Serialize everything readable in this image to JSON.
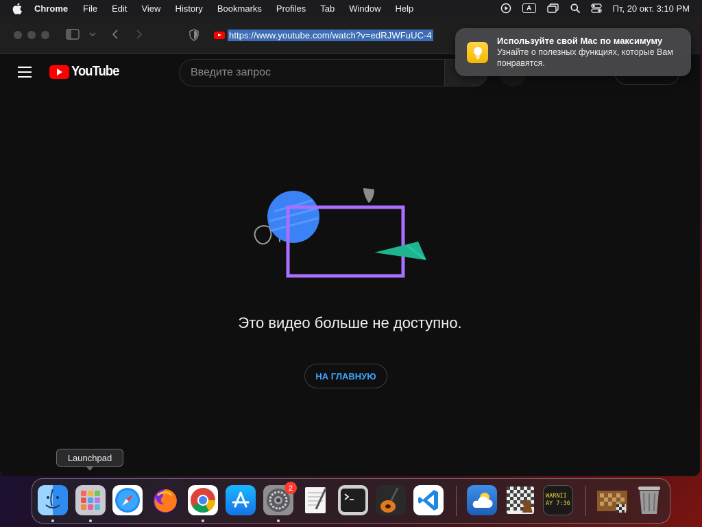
{
  "menubar": {
    "app_name": "Chrome",
    "items": [
      "File",
      "Edit",
      "View",
      "History",
      "Bookmarks",
      "Profiles",
      "Tab",
      "Window",
      "Help"
    ],
    "keyboard_indicator": "A",
    "clock": "Пт, 20 окт.  3:10 PM",
    "icons": [
      "apple-icon",
      "screen-record-icon",
      "keyboard-input-icon",
      "screen-mirroring-icon",
      "spotlight-search-icon",
      "control-center-icon"
    ]
  },
  "browser": {
    "url": "https://www.youtube.com/watch?v=edRJWFuUC-4"
  },
  "youtube": {
    "logo_text": "YouTube",
    "search_placeholder": "Введите запрос",
    "error_message": "Это видео больше не доступно.",
    "home_button": "НА ГЛАВНУЮ"
  },
  "notification": {
    "title": "Используйте свой Mac по максимуму",
    "body": "Узнайте о полезных функциях, которые Вам понравятся."
  },
  "dock": {
    "tooltip": "Launchpad",
    "apps": [
      {
        "name": "Finder",
        "icon": "finder-icon",
        "running": true
      },
      {
        "name": "Launchpad",
        "icon": "launchpad-icon",
        "running": true
      },
      {
        "name": "Safari",
        "icon": "safari-icon",
        "running": false
      },
      {
        "name": "Firefox",
        "icon": "firefox-icon",
        "running": false
      },
      {
        "name": "Google Chrome",
        "icon": "chrome-icon",
        "running": true
      },
      {
        "name": "App Store",
        "icon": "app-store-icon",
        "running": false
      },
      {
        "name": "System Settings",
        "icon": "system-settings-icon",
        "running": true,
        "badge": "2"
      },
      {
        "name": "TextEdit",
        "icon": "textedit-icon",
        "running": false
      },
      {
        "name": "Terminal",
        "icon": "terminal-icon",
        "running": false
      },
      {
        "name": "GarageBand",
        "icon": "garageband-icon",
        "running": false
      },
      {
        "name": "Visual Studio Code",
        "icon": "vscode-icon",
        "running": false
      },
      {
        "name": "Weather",
        "icon": "weather-icon",
        "running": false
      },
      {
        "name": "Chess",
        "icon": "chess-icon",
        "running": false
      },
      {
        "name": "Console",
        "icon": "console-icon",
        "running": false,
        "label_line1": "WARNII",
        "label_line2": "AY 7:36"
      },
      {
        "name": "Chess Document",
        "icon": "chess-document-icon",
        "running": false
      },
      {
        "name": "Trash",
        "icon": "trash-icon",
        "running": false
      }
    ]
  },
  "colors": {
    "youtube_red": "#ff0000",
    "link_blue": "#3ea6ff",
    "illustration_blue": "#3b82f6",
    "illustration_purple": "#a970ff",
    "illustration_teal": "#1fb38f"
  }
}
